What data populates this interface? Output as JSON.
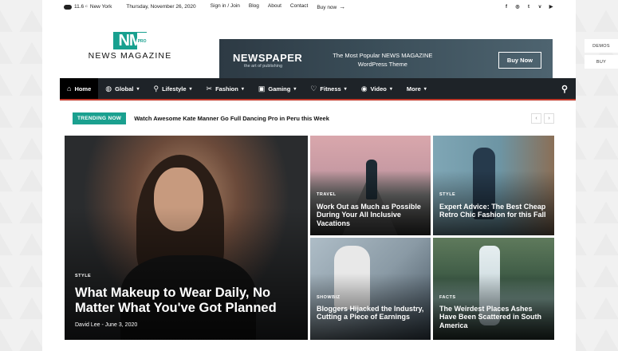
{
  "topbar": {
    "temperature": "11.6",
    "degree": "C",
    "city": "New York",
    "date": "Thursday, November 26, 2020",
    "links": [
      "Sign in / Join",
      "Blog",
      "About",
      "Contact",
      "Buy now"
    ],
    "socials": [
      "f",
      "◎",
      "t",
      "v",
      "▶"
    ]
  },
  "logo": {
    "mark": "NM",
    "pro": "PRO",
    "text": "NEWS MAGAZINE"
  },
  "banner": {
    "title": "NEWSPAPER",
    "subtitle": "the art of publishing",
    "tagline_1": "The Most Popular NEWS MAGAZINE",
    "tagline_2": "WordPress Theme",
    "button": "Buy Now"
  },
  "nav": {
    "items": [
      {
        "label": "Home",
        "icon": "⌂"
      },
      {
        "label": "Global",
        "icon": "◍"
      },
      {
        "label": "Lifestyle",
        "icon": "⚲"
      },
      {
        "label": "Fashion",
        "icon": "✂"
      },
      {
        "label": "Gaming",
        "icon": "▣"
      },
      {
        "label": "Fitness",
        "icon": "♡"
      },
      {
        "label": "Video",
        "icon": "◉"
      },
      {
        "label": "More",
        "icon": ""
      }
    ]
  },
  "trending": {
    "badge": "TRENDING NOW",
    "headline": "Watch Awesome Kate Manner Go Full Dancing Pro in Peru this Week"
  },
  "posts": {
    "main": {
      "category": "STYLE",
      "title": "What Makeup to Wear Daily, No Matter What You've Got Planned",
      "author": "David Lee",
      "date": "June 3, 2020"
    },
    "travel": {
      "category": "TRAVEL",
      "title": "Work Out as Much as Possible During Your All Inclusive Vacations"
    },
    "style": {
      "category": "STYLE",
      "title": "Expert Advice: The Best Cheap Retro Chic Fashion for this Fall"
    },
    "showbiz": {
      "category": "SHOWBIZ",
      "title": "Bloggers Hijacked the Industry, Cutting a Piece of Earnings"
    },
    "facts": {
      "category": "FACTS",
      "title": "The Weirdest Places Ashes Have Been Scattered in South America"
    }
  },
  "side": {
    "demos": "DEMOS",
    "buy": "BUY"
  },
  "colors": {
    "accent": "#1aa08f",
    "nav_bg": "#1e2328",
    "nav_border": "#c0392b"
  }
}
